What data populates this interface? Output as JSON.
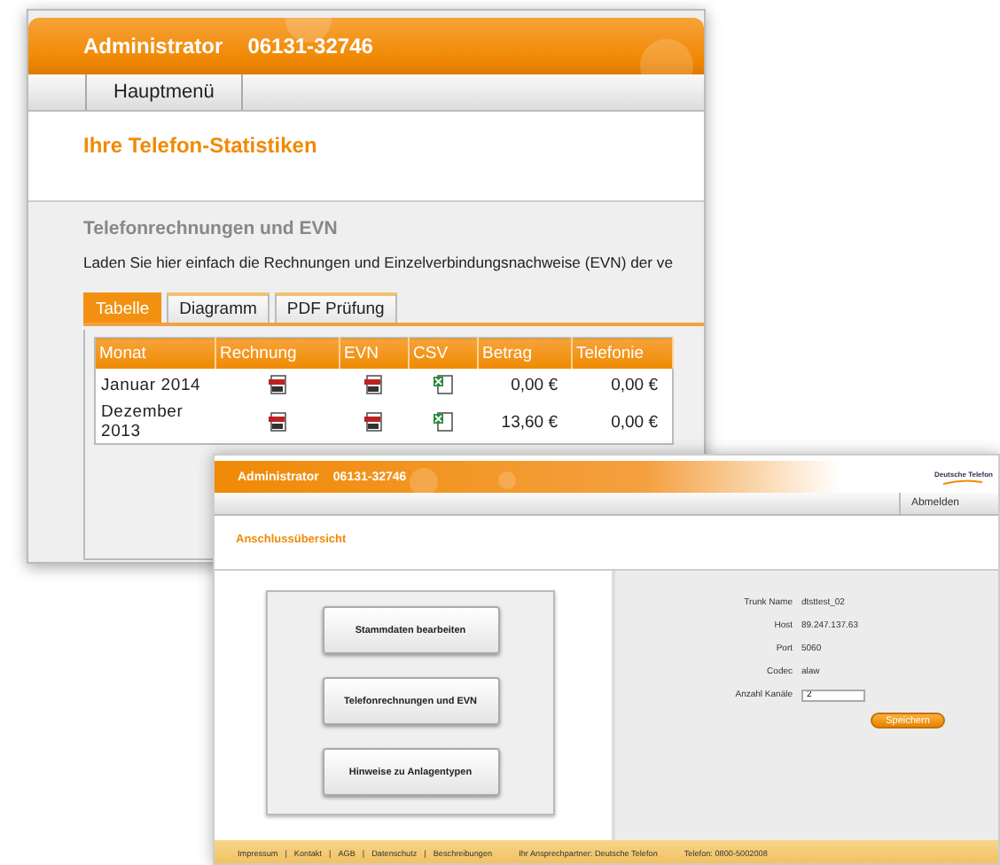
{
  "back_window": {
    "header": {
      "user": "Administrator",
      "phone": "06131-32746"
    },
    "menu": [
      {
        "label": "Hauptmenü",
        "selected": false
      }
    ],
    "page_title": "Ihre Telefon-Statistiken",
    "section": {
      "title": "Telefonrechnungen und EVN",
      "description": "Laden Sie hier einfach die Rechnungen und Einzelverbindungsnachweise (EVN) der ve"
    },
    "tabs": [
      {
        "label": "Tabelle",
        "selected": true
      },
      {
        "label": "Diagramm",
        "selected": false
      },
      {
        "label": "PDF Prüfung",
        "selected": false
      }
    ],
    "table": {
      "columns": [
        "Monat",
        "Rechnung",
        "EVN",
        "CSV",
        "Betrag",
        "Telefonie"
      ],
      "rows": [
        {
          "month": "Januar 2014",
          "amount": "0,00 €",
          "telephony": "0,00 €"
        },
        {
          "month": "Dezember 2013",
          "amount": "13,60 €",
          "telephony": "0,00 €"
        }
      ]
    }
  },
  "front_window": {
    "header": {
      "user": "Administrator",
      "phone": "06131-32746",
      "logo": "Deutsche Telefon"
    },
    "logout": "Abmelden",
    "page_title": "Anschlussübersicht",
    "actions": [
      "Stammdaten bearbeiten",
      "Telefonrechnungen und EVN",
      "Hinweise zu Anlagentypen"
    ],
    "details": [
      {
        "kind": "text",
        "label": "Trunk Name",
        "value": "dtsttest_02"
      },
      {
        "kind": "text",
        "label": "Host",
        "value": "89.247.137.63"
      },
      {
        "kind": "text",
        "label": "Port",
        "value": "5060"
      },
      {
        "kind": "text",
        "label": "Codec",
        "value": "alaw"
      },
      {
        "kind": "input",
        "label": "Anzahl Kanäle",
        "value": "2"
      }
    ],
    "save": "Speichern",
    "footer": {
      "items": [
        {
          "kind": "link",
          "text": "Impressum"
        },
        {
          "kind": "separator",
          "text": "|"
        },
        {
          "kind": "link",
          "text": "Kontakt"
        },
        {
          "kind": "separator",
          "text": "|"
        },
        {
          "kind": "link",
          "text": "AGB"
        },
        {
          "kind": "separator",
          "text": "|"
        },
        {
          "kind": "link",
          "text": "Datenschutz"
        },
        {
          "kind": "separator",
          "text": "|"
        },
        {
          "kind": "link",
          "text": "Beschreibungen"
        }
      ],
      "contact": "Ihr Ansprechpartner: Deutsche Telefon",
      "phone": "Telefon: 0800-5002008"
    }
  }
}
